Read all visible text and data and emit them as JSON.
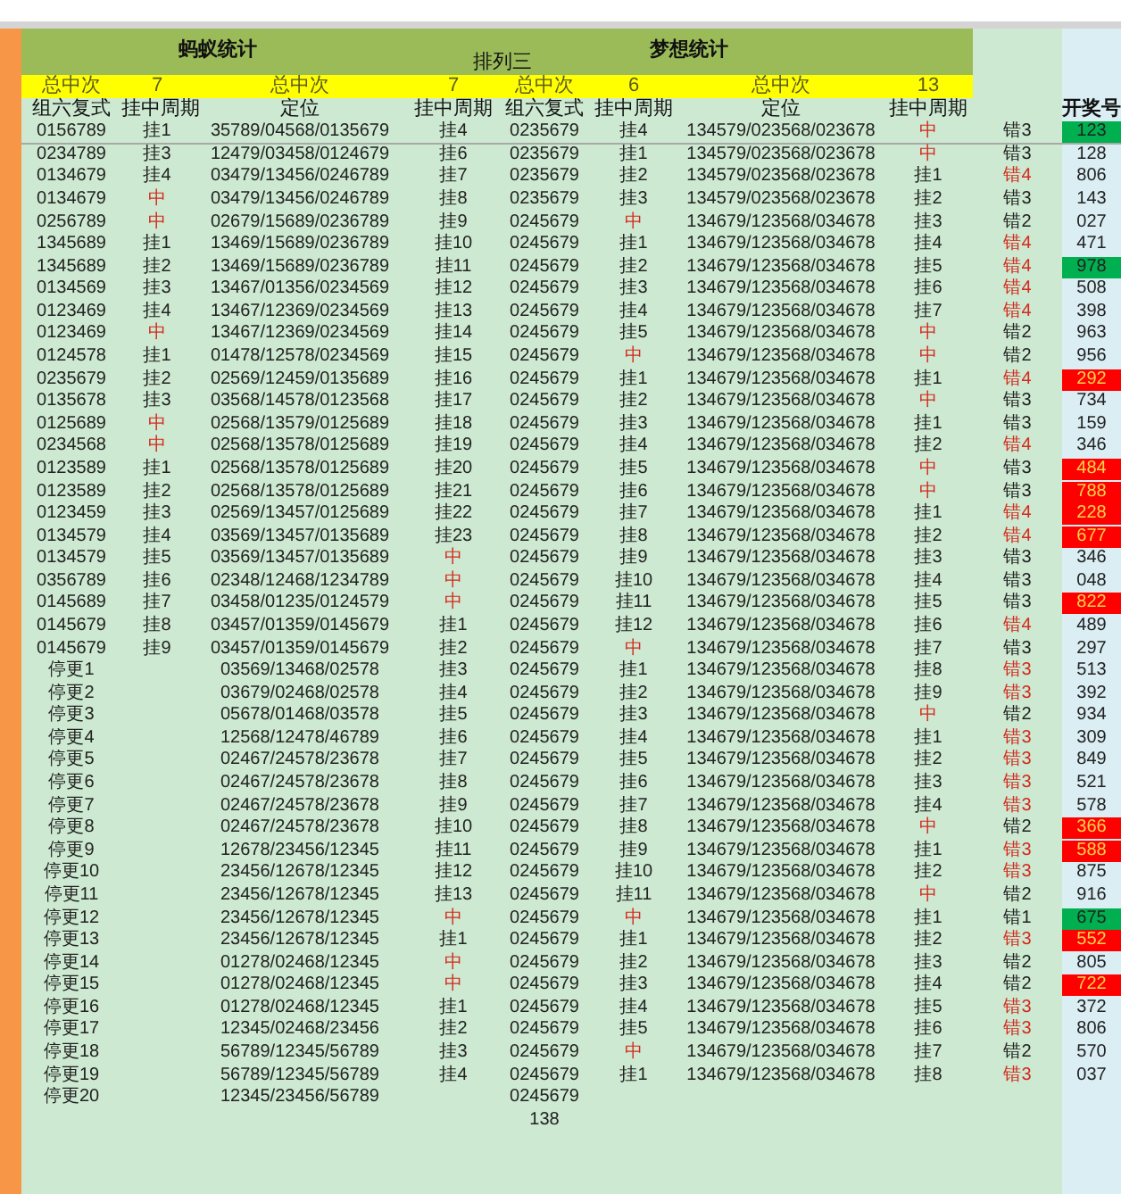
{
  "titles": {
    "left": "蚂蚁统计",
    "right": "梦想统计",
    "subtitle": "排列三"
  },
  "summary": [
    "总中次",
    "7",
    "总中次",
    "7",
    "总中次",
    "6",
    "总中次",
    "13"
  ],
  "columns": [
    "组六复式",
    "挂中周期",
    "定位",
    "挂中周期",
    "组六复式",
    "挂中周期",
    "定位",
    "挂中周期"
  ],
  "draw_header": "开奖号",
  "rows": [
    {
      "combo_a": "0156789",
      "position_a": "35789/04568/0135679",
      "combo_b": "0235679",
      "position_b": "134579/023568/023678",
      "cycles": [
        "挂1",
        "挂4",
        "挂4",
        "中"
      ],
      "hits": [
        false,
        false,
        false,
        true
      ],
      "miss": "错3",
      "miss_alert": false,
      "draw": "123",
      "draw_hit": true,
      "draw_alert": false
    },
    {
      "combo_a": "0234789",
      "position_a": "12479/03458/0124679",
      "combo_b": "0235679",
      "position_b": "134579/023568/023678",
      "cycles": [
        "挂3",
        "挂6",
        "挂1",
        "中"
      ],
      "hits": [
        false,
        false,
        false,
        true
      ],
      "miss": "错3",
      "miss_alert": false,
      "draw": "128",
      "draw_hit": false,
      "draw_alert": false
    },
    {
      "combo_a": "0134679",
      "position_a": "03479/13456/0246789",
      "combo_b": "0235679",
      "position_b": "134579/023568/023678",
      "cycles": [
        "挂4",
        "挂7",
        "挂2",
        "挂1"
      ],
      "hits": [
        false,
        false,
        false,
        false
      ],
      "miss": "错4",
      "miss_alert": true,
      "draw": "806",
      "draw_hit": false,
      "draw_alert": false
    },
    {
      "combo_a": "0134679",
      "position_a": "03479/13456/0246789",
      "combo_b": "0235679",
      "position_b": "134579/023568/023678",
      "cycles": [
        "中",
        "挂8",
        "挂3",
        "挂2"
      ],
      "hits": [
        true,
        false,
        false,
        false
      ],
      "miss": "错3",
      "miss_alert": false,
      "draw": "143",
      "draw_hit": false,
      "draw_alert": false
    },
    {
      "combo_a": "0256789",
      "position_a": "02679/15689/0236789",
      "combo_b": "0245679",
      "position_b": "134679/123568/034678",
      "cycles": [
        "中",
        "挂9",
        "中",
        "挂3"
      ],
      "hits": [
        true,
        false,
        true,
        false
      ],
      "miss": "错2",
      "miss_alert": false,
      "draw": "027",
      "draw_hit": false,
      "draw_alert": false
    },
    {
      "combo_a": "1345689",
      "position_a": "13469/15689/0236789",
      "combo_b": "0245679",
      "position_b": "134679/123568/034678",
      "cycles": [
        "挂1",
        "挂10",
        "挂1",
        "挂4"
      ],
      "hits": [
        false,
        false,
        false,
        false
      ],
      "miss": "错4",
      "miss_alert": true,
      "draw": "471",
      "draw_hit": false,
      "draw_alert": false
    },
    {
      "combo_a": "1345689",
      "position_a": "13469/15689/0236789",
      "combo_b": "0245679",
      "position_b": "134679/123568/034678",
      "cycles": [
        "挂2",
        "挂11",
        "挂2",
        "挂5"
      ],
      "hits": [
        false,
        false,
        false,
        false
      ],
      "miss": "错4",
      "miss_alert": true,
      "draw": "978",
      "draw_hit": true,
      "draw_alert": false
    },
    {
      "combo_a": "0134569",
      "position_a": "13467/01356/0234569",
      "combo_b": "0245679",
      "position_b": "134679/123568/034678",
      "cycles": [
        "挂3",
        "挂12",
        "挂3",
        "挂6"
      ],
      "hits": [
        false,
        false,
        false,
        false
      ],
      "miss": "错4",
      "miss_alert": true,
      "draw": "508",
      "draw_hit": false,
      "draw_alert": false
    },
    {
      "combo_a": "0123469",
      "position_a": "13467/12369/0234569",
      "combo_b": "0245679",
      "position_b": "134679/123568/034678",
      "cycles": [
        "挂4",
        "挂13",
        "挂4",
        "挂7"
      ],
      "hits": [
        false,
        false,
        false,
        false
      ],
      "miss": "错4",
      "miss_alert": true,
      "draw": "398",
      "draw_hit": false,
      "draw_alert": false
    },
    {
      "combo_a": "0123469",
      "position_a": "13467/12369/0234569",
      "combo_b": "0245679",
      "position_b": "134679/123568/034678",
      "cycles": [
        "中",
        "挂14",
        "挂5",
        "中"
      ],
      "hits": [
        true,
        false,
        false,
        true
      ],
      "miss": "错2",
      "miss_alert": false,
      "draw": "963",
      "draw_hit": false,
      "draw_alert": false
    },
    {
      "combo_a": "0124578",
      "position_a": "01478/12578/0234569",
      "combo_b": "0245679",
      "position_b": "134679/123568/034678",
      "cycles": [
        "挂1",
        "挂15",
        "中",
        "中"
      ],
      "hits": [
        false,
        false,
        true,
        true
      ],
      "miss": "错2",
      "miss_alert": false,
      "draw": "956",
      "draw_hit": false,
      "draw_alert": false
    },
    {
      "combo_a": "0235679",
      "position_a": "02569/12459/0135689",
      "combo_b": "0245679",
      "position_b": "134679/123568/034678",
      "cycles": [
        "挂2",
        "挂16",
        "挂1",
        "挂1"
      ],
      "hits": [
        false,
        false,
        false,
        false
      ],
      "miss": "错4",
      "miss_alert": true,
      "draw": "292",
      "draw_hit": false,
      "draw_alert": true
    },
    {
      "combo_a": "0135678",
      "position_a": "03568/14578/0123568",
      "combo_b": "0245679",
      "position_b": "134679/123568/034678",
      "cycles": [
        "挂3",
        "挂17",
        "挂2",
        "中"
      ],
      "hits": [
        false,
        false,
        false,
        true
      ],
      "miss": "错3",
      "miss_alert": false,
      "draw": "734",
      "draw_hit": false,
      "draw_alert": false
    },
    {
      "combo_a": "0125689",
      "position_a": "02568/13579/0125689",
      "combo_b": "0245679",
      "position_b": "134679/123568/034678",
      "cycles": [
        "中",
        "挂18",
        "挂3",
        "挂1"
      ],
      "hits": [
        true,
        false,
        false,
        false
      ],
      "miss": "错3",
      "miss_alert": false,
      "draw": "159",
      "draw_hit": false,
      "draw_alert": false
    },
    {
      "combo_a": "0234568",
      "position_a": "02568/13578/0125689",
      "combo_b": "0245679",
      "position_b": "134679/123568/034678",
      "cycles": [
        "中",
        "挂19",
        "挂4",
        "挂2"
      ],
      "hits": [
        true,
        false,
        false,
        false
      ],
      "miss": "错4",
      "miss_alert": true,
      "draw": "346",
      "draw_hit": false,
      "draw_alert": false
    },
    {
      "combo_a": "0123589",
      "position_a": "02568/13578/0125689",
      "combo_b": "0245679",
      "position_b": "134679/123568/034678",
      "cycles": [
        "挂1",
        "挂20",
        "挂5",
        "中"
      ],
      "hits": [
        false,
        false,
        false,
        true
      ],
      "miss": "错3",
      "miss_alert": false,
      "draw": "484",
      "draw_hit": false,
      "draw_alert": true
    },
    {
      "combo_a": "0123589",
      "position_a": "02568/13578/0125689",
      "combo_b": "0245679",
      "position_b": "134679/123568/034678",
      "cycles": [
        "挂2",
        "挂21",
        "挂6",
        "中"
      ],
      "hits": [
        false,
        false,
        false,
        true
      ],
      "miss": "错3",
      "miss_alert": false,
      "draw": "788",
      "draw_hit": false,
      "draw_alert": true
    },
    {
      "combo_a": "0123459",
      "position_a": "02569/13457/0125689",
      "combo_b": "0245679",
      "position_b": "134679/123568/034678",
      "cycles": [
        "挂3",
        "挂22",
        "挂7",
        "挂1"
      ],
      "hits": [
        false,
        false,
        false,
        false
      ],
      "miss": "错4",
      "miss_alert": true,
      "draw": "228",
      "draw_hit": false,
      "draw_alert": true
    },
    {
      "combo_a": "0134579",
      "position_a": "03569/13457/0135689",
      "combo_b": "0245679",
      "position_b": "134679/123568/034678",
      "cycles": [
        "挂4",
        "挂23",
        "挂8",
        "挂2"
      ],
      "hits": [
        false,
        false,
        false,
        false
      ],
      "miss": "错4",
      "miss_alert": true,
      "draw": "677",
      "draw_hit": false,
      "draw_alert": true
    },
    {
      "combo_a": "0134579",
      "position_a": "03569/13457/0135689",
      "combo_b": "0245679",
      "position_b": "134679/123568/034678",
      "cycles": [
        "挂5",
        "中",
        "挂9",
        "挂3"
      ],
      "hits": [
        false,
        true,
        false,
        false
      ],
      "miss": "错3",
      "miss_alert": false,
      "draw": "346",
      "draw_hit": false,
      "draw_alert": false
    },
    {
      "combo_a": "0356789",
      "position_a": "02348/12468/1234789",
      "combo_b": "0245679",
      "position_b": "134679/123568/034678",
      "cycles": [
        "挂6",
        "中",
        "挂10",
        "挂4"
      ],
      "hits": [
        false,
        true,
        false,
        false
      ],
      "miss": "错3",
      "miss_alert": false,
      "draw": "048",
      "draw_hit": false,
      "draw_alert": false
    },
    {
      "combo_a": "0145689",
      "position_a": "03458/01235/0124579",
      "combo_b": "0245679",
      "position_b": "134679/123568/034678",
      "cycles": [
        "挂7",
        "中",
        "挂11",
        "挂5"
      ],
      "hits": [
        false,
        true,
        false,
        false
      ],
      "miss": "错3",
      "miss_alert": false,
      "draw": "822",
      "draw_hit": false,
      "draw_alert": true
    },
    {
      "combo_a": "0145679",
      "position_a": "03457/01359/0145679",
      "combo_b": "0245679",
      "position_b": "134679/123568/034678",
      "cycles": [
        "挂8",
        "挂1",
        "挂12",
        "挂6"
      ],
      "hits": [
        false,
        false,
        false,
        false
      ],
      "miss": "错4",
      "miss_alert": true,
      "draw": "489",
      "draw_hit": false,
      "draw_alert": false
    },
    {
      "combo_a": "0145679",
      "position_a": "03457/01359/0145679",
      "combo_b": "0245679",
      "position_b": "134679/123568/034678",
      "cycles": [
        "挂9",
        "挂2",
        "中",
        "挂7"
      ],
      "hits": [
        false,
        false,
        true,
        false
      ],
      "miss": "错3",
      "miss_alert": false,
      "draw": "297",
      "draw_hit": false,
      "draw_alert": false
    },
    {
      "combo_a": "停更1",
      "position_a": "03569/13468/02578",
      "combo_b": "0245679",
      "position_b": "134679/123568/034678",
      "cycles": [
        "挂3",
        "挂1",
        "挂8"
      ],
      "hits": [
        false,
        false,
        false
      ],
      "miss": "错3",
      "miss_alert": true,
      "draw": "513",
      "draw_hit": false,
      "draw_alert": false
    },
    {
      "combo_a": "停更2",
      "position_a": "03679/02468/02578",
      "combo_b": "0245679",
      "position_b": "134679/123568/034678",
      "cycles": [
        "挂4",
        "挂2",
        "挂9"
      ],
      "hits": [
        false,
        false,
        false
      ],
      "miss": "错3",
      "miss_alert": true,
      "draw": "392",
      "draw_hit": false,
      "draw_alert": false
    },
    {
      "combo_a": "停更3",
      "position_a": "05678/01468/03578",
      "combo_b": "0245679",
      "position_b": "134679/123568/034678",
      "cycles": [
        "挂5",
        "挂3",
        "中"
      ],
      "hits": [
        false,
        false,
        true
      ],
      "miss": "错2",
      "miss_alert": false,
      "draw": "934",
      "draw_hit": false,
      "draw_alert": false
    },
    {
      "combo_a": "停更4",
      "position_a": "12568/12478/46789",
      "combo_b": "0245679",
      "position_b": "134679/123568/034678",
      "cycles": [
        "挂6",
        "挂4",
        "挂1"
      ],
      "hits": [
        false,
        false,
        false
      ],
      "miss": "错3",
      "miss_alert": true,
      "draw": "309",
      "draw_hit": false,
      "draw_alert": false
    },
    {
      "combo_a": "停更5",
      "position_a": "02467/24578/23678",
      "combo_b": "0245679",
      "position_b": "134679/123568/034678",
      "cycles": [
        "挂7",
        "挂5",
        "挂2"
      ],
      "hits": [
        false,
        false,
        false
      ],
      "miss": "错3",
      "miss_alert": true,
      "draw": "849",
      "draw_hit": false,
      "draw_alert": false
    },
    {
      "combo_a": "停更6",
      "position_a": "02467/24578/23678",
      "combo_b": "0245679",
      "position_b": "134679/123568/034678",
      "cycles": [
        "挂8",
        "挂6",
        "挂3"
      ],
      "hits": [
        false,
        false,
        false
      ],
      "miss": "错3",
      "miss_alert": true,
      "draw": "521",
      "draw_hit": false,
      "draw_alert": false
    },
    {
      "combo_a": "停更7",
      "position_a": "02467/24578/23678",
      "combo_b": "0245679",
      "position_b": "134679/123568/034678",
      "cycles": [
        "挂9",
        "挂7",
        "挂4"
      ],
      "hits": [
        false,
        false,
        false
      ],
      "miss": "错3",
      "miss_alert": true,
      "draw": "578",
      "draw_hit": false,
      "draw_alert": false
    },
    {
      "combo_a": "停更8",
      "position_a": "02467/24578/23678",
      "combo_b": "0245679",
      "position_b": "134679/123568/034678",
      "cycles": [
        "挂10",
        "挂8",
        "中"
      ],
      "hits": [
        false,
        false,
        true
      ],
      "miss": "错2",
      "miss_alert": false,
      "draw": "366",
      "draw_hit": false,
      "draw_alert": true
    },
    {
      "combo_a": "停更9",
      "position_a": "12678/23456/12345",
      "combo_b": "0245679",
      "position_b": "134679/123568/034678",
      "cycles": [
        "挂11",
        "挂9",
        "挂1"
      ],
      "hits": [
        false,
        false,
        false
      ],
      "miss": "错3",
      "miss_alert": true,
      "draw": "588",
      "draw_hit": false,
      "draw_alert": true
    },
    {
      "combo_a": "停更10",
      "position_a": "23456/12678/12345",
      "combo_b": "0245679",
      "position_b": "134679/123568/034678",
      "cycles": [
        "挂12",
        "挂10",
        "挂2"
      ],
      "hits": [
        false,
        false,
        false
      ],
      "miss": "错3",
      "miss_alert": true,
      "draw": "875",
      "draw_hit": false,
      "draw_alert": false
    },
    {
      "combo_a": "停更11",
      "position_a": "23456/12678/12345",
      "combo_b": "0245679",
      "position_b": "134679/123568/034678",
      "cycles": [
        "挂13",
        "挂11",
        "中"
      ],
      "hits": [
        false,
        false,
        true
      ],
      "miss": "错2",
      "miss_alert": false,
      "draw": "916",
      "draw_hit": false,
      "draw_alert": false
    },
    {
      "combo_a": "停更12",
      "position_a": "23456/12678/12345",
      "combo_b": "0245679",
      "position_b": "134679/123568/034678",
      "cycles": [
        "中",
        "中",
        "挂1"
      ],
      "hits": [
        true,
        true,
        false
      ],
      "miss": "错1",
      "miss_alert": false,
      "draw": "675",
      "draw_hit": true,
      "draw_alert": false
    },
    {
      "combo_a": "停更13",
      "position_a": "23456/12678/12345",
      "combo_b": "0245679",
      "position_b": "134679/123568/034678",
      "cycles": [
        "挂1",
        "挂1",
        "挂2"
      ],
      "hits": [
        false,
        false,
        false
      ],
      "miss": "错3",
      "miss_alert": true,
      "draw": "552",
      "draw_hit": false,
      "draw_alert": true
    },
    {
      "combo_a": "停更14",
      "position_a": "01278/02468/12345",
      "combo_b": "0245679",
      "position_b": "134679/123568/034678",
      "cycles": [
        "中",
        "挂2",
        "挂3"
      ],
      "hits": [
        true,
        false,
        false
      ],
      "miss": "错2",
      "miss_alert": false,
      "draw": "805",
      "draw_hit": false,
      "draw_alert": false
    },
    {
      "combo_a": "停更15",
      "position_a": "01278/02468/12345",
      "combo_b": "0245679",
      "position_b": "134679/123568/034678",
      "cycles": [
        "中",
        "挂3",
        "挂4"
      ],
      "hits": [
        true,
        false,
        false
      ],
      "miss": "错2",
      "miss_alert": false,
      "draw": "722",
      "draw_hit": false,
      "draw_alert": true
    },
    {
      "combo_a": "停更16",
      "position_a": "01278/02468/12345",
      "combo_b": "0245679",
      "position_b": "134679/123568/034678",
      "cycles": [
        "挂1",
        "挂4",
        "挂5"
      ],
      "hits": [
        false,
        false,
        false
      ],
      "miss": "错3",
      "miss_alert": true,
      "draw": "372",
      "draw_hit": false,
      "draw_alert": false
    },
    {
      "combo_a": "停更17",
      "position_a": "12345/02468/23456",
      "combo_b": "0245679",
      "position_b": "134679/123568/034678",
      "cycles": [
        "挂2",
        "挂5",
        "挂6"
      ],
      "hits": [
        false,
        false,
        false
      ],
      "miss": "错3",
      "miss_alert": true,
      "draw": "806",
      "draw_hit": false,
      "draw_alert": false
    },
    {
      "combo_a": "停更18",
      "position_a": "56789/12345/56789",
      "combo_b": "0245679",
      "position_b": "134679/123568/034678",
      "cycles": [
        "挂3",
        "中",
        "挂7"
      ],
      "hits": [
        false,
        true,
        false
      ],
      "miss": "错2",
      "miss_alert": false,
      "draw": "570",
      "draw_hit": false,
      "draw_alert": false
    },
    {
      "combo_a": "停更19",
      "position_a": "56789/12345/56789",
      "combo_b": "0245679",
      "position_b": "134679/123568/034678",
      "cycles": [
        "挂4",
        "挂1",
        "挂8"
      ],
      "hits": [
        false,
        false,
        false
      ],
      "miss": "错3",
      "miss_alert": true,
      "draw": "037",
      "draw_hit": false,
      "draw_alert": false
    },
    {
      "combo_a": "停更20",
      "position_a": "12345/23456/56789",
      "combo_b": "0245679"
    }
  ],
  "footer_count": "138"
}
